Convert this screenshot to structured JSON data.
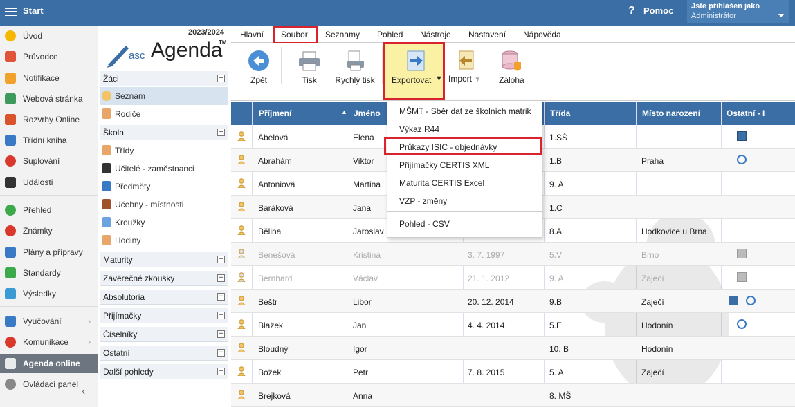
{
  "topbar": {
    "start_label": "Start",
    "help_label": "Pomoc",
    "user_heading": "Jste přihlášen jako",
    "user_name": "Administrátor"
  },
  "leftnav": [
    {
      "label": "Úvod",
      "icon": "star-icon"
    },
    {
      "label": "Průvodce",
      "icon": "wand-icon"
    },
    {
      "label": "Notifikace",
      "icon": "mail-icon"
    },
    {
      "label": "Webová stránka",
      "icon": "home-icon"
    },
    {
      "label": "Rozvrhy Online",
      "icon": "timetable-icon"
    },
    {
      "label": "Třídní kniha",
      "icon": "book-icon"
    },
    {
      "label": "Suplování",
      "icon": "substitution-icon"
    },
    {
      "label": "Události",
      "icon": "calendar-icon"
    },
    {
      "label": "Přehled",
      "icon": "check-icon"
    },
    {
      "label": "Známky",
      "icon": "grades-icon"
    },
    {
      "label": "Plány a přípravy",
      "icon": "briefcase-icon"
    },
    {
      "label": "Standardy",
      "icon": "shield-icon"
    },
    {
      "label": "Výsledky",
      "icon": "barchart-icon"
    },
    {
      "label": "Vyučování",
      "icon": "teaching-icon"
    },
    {
      "label": "Komunikace",
      "icon": "chat-icon"
    },
    {
      "label": "Agenda online",
      "icon": "agenda-icon"
    },
    {
      "label": "Ovládací panel",
      "icon": "gear-icon"
    }
  ],
  "side": {
    "year": "2023/2024",
    "logo_asc": "asc",
    "logo_agenda": "Agenda",
    "logo_tm": "TM",
    "sections": [
      {
        "label": "Žáci",
        "toggle": "−"
      },
      {
        "label": "Škola",
        "toggle": "−"
      },
      {
        "label": "Maturity",
        "toggle": "+"
      },
      {
        "label": "Závěrečné zkoušky",
        "toggle": "+"
      },
      {
        "label": "Absolutoria",
        "toggle": "+"
      },
      {
        "label": "Přijímačky",
        "toggle": "+"
      },
      {
        "label": "Číselníky",
        "toggle": "+"
      },
      {
        "label": "Ostatní",
        "toggle": "+"
      },
      {
        "label": "Další pohledy",
        "toggle": "+"
      }
    ],
    "zaci_items": [
      "Seznam",
      "Rodiče"
    ],
    "skola_items": [
      "Třídy",
      "Učitelé - zaměstnanci",
      "Předměty",
      "Učebny - místnosti",
      "Kroužky",
      "Hodiny"
    ]
  },
  "menu": [
    "Hlavní",
    "Soubor",
    "Seznamy",
    "Pohled",
    "Nástroje",
    "Nastavení",
    "Nápověda"
  ],
  "toolbar": {
    "back": "Zpět",
    "print": "Tisk",
    "quick_print": "Rychlý tisk",
    "export": "Exportovat",
    "import": "Import",
    "backup": "Záloha"
  },
  "dropdown": [
    "MŠMT - Sběr dat ze školních matrik",
    "Výkaz R44",
    "Průkazy ISIC - objednávky",
    "Přijímačky CERTIS XML",
    "Maturita CERTIS Excel",
    "VZP - změny",
    "Pohled - CSV"
  ],
  "table": {
    "headers": [
      "Příjmení",
      "Jméno",
      "Třída",
      "Místo narození",
      "Ostatní - I"
    ],
    "rows": [
      {
        "surname": "Abelová",
        "name": "Elena",
        "date": "",
        "class": "1.SŠ",
        "place": ""
      },
      {
        "surname": "Abrahám",
        "name": "Viktor",
        "date": "",
        "class": "1.B",
        "place": "Praha"
      },
      {
        "surname": "Antoniová",
        "name": "Martina",
        "date": "",
        "class": "9. A",
        "place": ""
      },
      {
        "surname": "Baráková",
        "name": "Jana",
        "date": "",
        "class": "1.C",
        "place": ""
      },
      {
        "surname": "Bělina",
        "name": "Jaroslav",
        "date": "",
        "class": "8.A",
        "place": "Hodkovice u Brna"
      },
      {
        "surname": "Benešová",
        "name": "Kristina",
        "date": "3. 7. 1997",
        "class": "5.V",
        "place": "Brno"
      },
      {
        "surname": "Bernhard",
        "name": "Václav",
        "date": "21. 1. 2012",
        "class": "9. A",
        "place": "Zaječí"
      },
      {
        "surname": "Beštr",
        "name": "Libor",
        "date": "20. 12. 2014",
        "class": "9.B",
        "place": "Zaječí"
      },
      {
        "surname": "Blažek",
        "name": "Jan",
        "date": "4. 4. 2014",
        "class": "5.E",
        "place": "Hodonín"
      },
      {
        "surname": "Bloudný",
        "name": "Igor",
        "date": "",
        "class": "10. B",
        "place": "Hodonín"
      },
      {
        "surname": "Božek",
        "name": "Petr",
        "date": "7. 8. 2015",
        "class": "5. A",
        "place": "Zaječí"
      },
      {
        "surname": "Brejková",
        "name": "Anna",
        "date": "",
        "class": "8. MŠ",
        "place": ""
      }
    ]
  },
  "colors": {
    "header_blue": "#3a6ea5",
    "highlight_red": "#d9232d",
    "export_yellow": "#fbf1a5"
  }
}
